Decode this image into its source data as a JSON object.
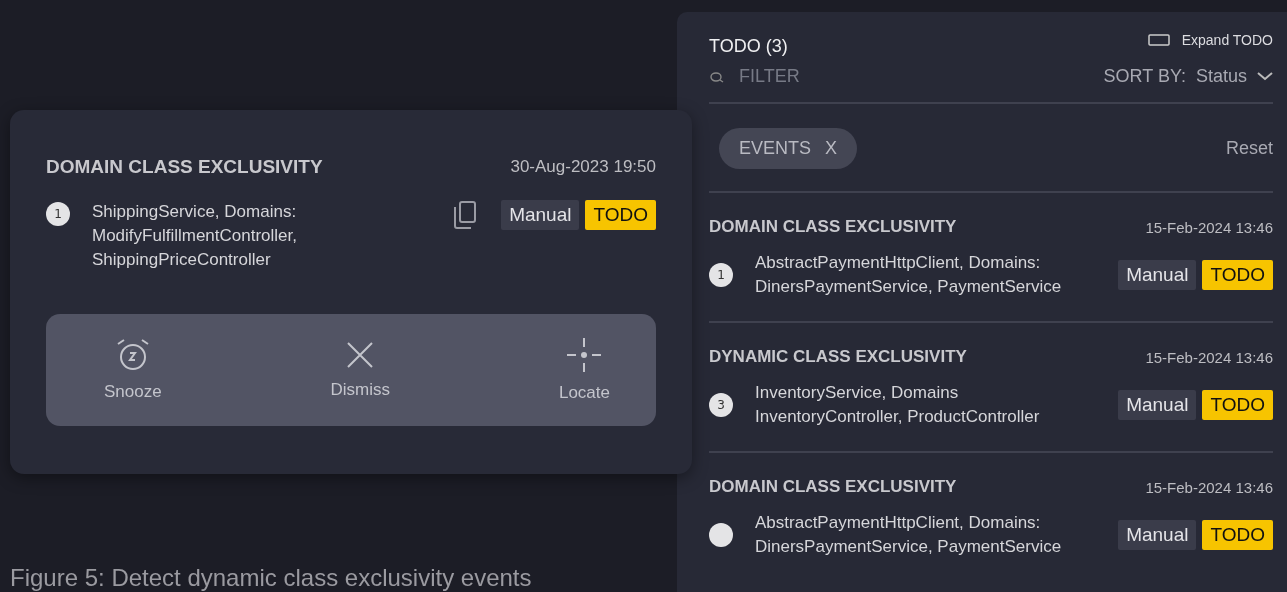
{
  "detail_card": {
    "title": "DOMAIN CLASS EXCLUSIVITY",
    "timestamp": "30-Aug-2023 19:50",
    "number": "1",
    "description": "ShippingService, Domains: ModifyFulfillmentController, ShippingPriceController",
    "type_tag": "Manual",
    "status_tag": "TODO",
    "actions": [
      {
        "kind": "snooze",
        "label": "Snooze"
      },
      {
        "kind": "dismiss",
        "label": "Dismiss"
      },
      {
        "kind": "locate",
        "label": "Locate"
      }
    ]
  },
  "caption": "Figure 5: Detect dynamic class exclusivity events",
  "todo_panel": {
    "title": "TODO (3)",
    "expand_label": "Expand TODO",
    "filter_placeholder": "FILTER",
    "sort_label": "SORT BY:",
    "sort_value": "Status",
    "chip": "EVENTS",
    "chip_remove": "X",
    "reset": "Reset",
    "items": [
      {
        "title": "DOMAIN CLASS EXCLUSIVITY",
        "timestamp": "15-Feb-2024 13:46",
        "number": "1",
        "description": "AbstractPaymentHttpClient, Domains: DinersPaymentService, PaymentService",
        "type_tag": "Manual",
        "status_tag": "TODO"
      },
      {
        "title": "DYNAMIC CLASS EXCLUSIVITY",
        "timestamp": "15-Feb-2024 13:46",
        "number": "3",
        "description": "InventoryService, Domains InventoryController, ProductController",
        "type_tag": "Manual",
        "status_tag": "TODO"
      },
      {
        "title": "DOMAIN CLASS EXCLUSIVITY",
        "timestamp": "15-Feb-2024 13:46",
        "description": "AbstractPaymentHttpClient, Domains: DinersPaymentService, PaymentService",
        "type_tag": "Manual",
        "status_tag": "TODO"
      }
    ]
  }
}
